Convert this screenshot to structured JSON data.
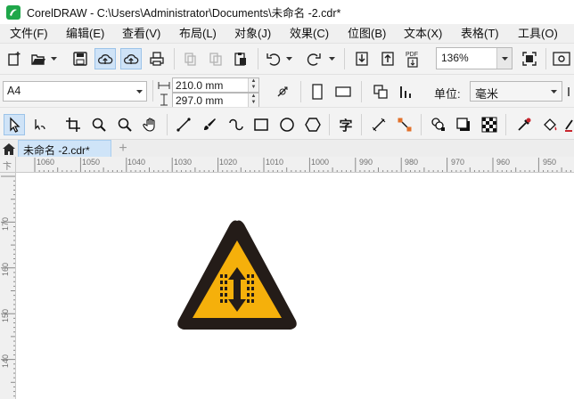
{
  "window": {
    "title": "CorelDRAW - C:\\Users\\Administrator\\Documents\\未命名 -2.cdr*"
  },
  "menu": {
    "items": [
      "文件(F)",
      "编辑(E)",
      "查看(V)",
      "布局(L)",
      "对象(J)",
      "效果(C)",
      "位图(B)",
      "文本(X)",
      "表格(T)",
      "工具(O)"
    ]
  },
  "toolbar": {
    "zoom": "136%",
    "pdf_label": "PDF"
  },
  "property_bar": {
    "page_size": "A4",
    "width": "210.0 mm",
    "height": "297.0 mm",
    "unit_label": "单位:",
    "unit_value": "毫米"
  },
  "toolbox": {
    "text_tool_glyph": "字"
  },
  "doc_tabs": {
    "active_tab": "未命名 -2.cdr*",
    "add_tab": "+"
  },
  "rulers": {
    "horizontal": [
      "1060",
      "1050",
      "1040",
      "1030",
      "1020",
      "1010",
      "1000",
      "990",
      "980",
      "970",
      "960",
      "950"
    ],
    "vertical": [
      "170",
      "160",
      "150",
      "140"
    ],
    "corner_glyph": "卞"
  },
  "colors": {
    "sign_border": "#241c18",
    "sign_fill": "#f5b00b",
    "accent_active": "#cfe3f7"
  }
}
